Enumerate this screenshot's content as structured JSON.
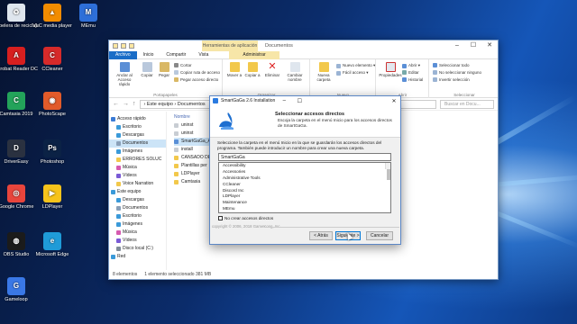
{
  "desktop_icons": [
    {
      "label": "Papelera de reciclaje",
      "icon": "recycle-bin-icon",
      "color": "#dfe6ee",
      "glyph": "♻"
    },
    {
      "label": "VLC media player",
      "icon": "vlc-icon",
      "color": "#f28c00",
      "glyph": "▲"
    },
    {
      "label": "MEmu",
      "icon": "memu-icon",
      "color": "#2e6fd8",
      "glyph": "M"
    },
    {
      "label": "Acrobat Reader DC",
      "icon": "acrobat-icon",
      "color": "#d71f1f",
      "glyph": "A"
    },
    {
      "label": "CCleaner",
      "icon": "ccleaner-icon",
      "color": "#d62a2a",
      "glyph": "C"
    },
    {
      "label": "Camtasia 2019",
      "icon": "camtasia-icon",
      "color": "#23a35a",
      "glyph": "C"
    },
    {
      "label": "PhotoScape",
      "icon": "photoscape-icon",
      "color": "#e25b2a",
      "glyph": "◉"
    },
    {
      "label": "DriverEasy",
      "icon": "drivereasy-icon",
      "color": "#2a3140",
      "glyph": "D"
    },
    {
      "label": "Photoshop",
      "icon": "photoshop-icon",
      "color": "#0b2245",
      "glyph": "Ps"
    },
    {
      "label": "Google Chrome",
      "icon": "chrome-icon",
      "color": "#e8453c",
      "glyph": "◎"
    },
    {
      "label": "LDPlayer",
      "icon": "ldplayer-icon",
      "color": "#f6c31b",
      "glyph": "▶"
    },
    {
      "label": "OBS Studio",
      "icon": "obs-icon",
      "color": "#1b1b1b",
      "glyph": "◍"
    },
    {
      "label": "Microsoft Edge",
      "icon": "edge-icon",
      "color": "#1f9bd8",
      "glyph": "e"
    },
    {
      "label": "Gameloop",
      "icon": "gameloop-icon",
      "color": "#3a78e6",
      "glyph": "G"
    }
  ],
  "explorer": {
    "title": "Documentos",
    "context_tab": "Herramientas de aplicación",
    "tabs": [
      "Archivo",
      "Inicio",
      "Compartir",
      "Vista",
      "Administrar"
    ],
    "ribbon": {
      "anclar": "Anclar al Acceso rápido",
      "copiar": "Copiar",
      "pegar": "Pegar",
      "cortar": "Cortar",
      "copiar_ruta": "Copiar ruta de acceso",
      "pegar_acceso": "Pegar acceso directo",
      "group_portapapeles": "Portapapeles",
      "mover": "Mover a",
      "copiar_a": "Copiar a",
      "eliminar": "Eliminar",
      "cambiar_nombre": "Cambiar nombre",
      "group_organizar": "Organizar",
      "nueva_carpeta": "Nueva carpeta",
      "nuevo_elemento": "Nuevo elemento ▾",
      "facil_acceso": "Fácil acceso ▾",
      "group_nuevo": "Nuevo",
      "propiedades": "Propiedades",
      "abrir": "Abrir ▾",
      "editar": "Editar",
      "historial": "Historial",
      "group_abrir": "Abrir",
      "sel_todo": "Seleccionar todo",
      "no_sel": "No seleccionar ninguno",
      "invertir": "Invertir selección",
      "group_seleccionar": "Seleccionar"
    },
    "address": "›  Este equipo  ›  Documentos",
    "search_placeholder": "Buscar en Docu...",
    "nav": [
      {
        "label": "Acceso rápido",
        "icon": "star-icon",
        "color": "#3a7bd5"
      },
      {
        "label": "Escritorio",
        "icon": "desktop-folder-icon",
        "color": "#3a9ad9"
      },
      {
        "label": "Descargas",
        "icon": "download-icon",
        "color": "#3a9ad9"
      },
      {
        "label": "Documentos",
        "icon": "documents-icon",
        "color": "#8aa0b8",
        "selected": true
      },
      {
        "label": "Imágenes",
        "icon": "pictures-icon",
        "color": "#3a9ad9"
      },
      {
        "label": "ERRORES SOLUC",
        "icon": "folder-icon",
        "color": "#f2c84b"
      },
      {
        "label": "Música",
        "icon": "music-icon",
        "color": "#d65ab0"
      },
      {
        "label": "Vídeos",
        "icon": "videos-icon",
        "color": "#7a5ad6"
      },
      {
        "label": "Voice Narration",
        "icon": "folder-icon",
        "color": "#f2c84b"
      },
      {
        "label": "Este equipo",
        "icon": "pc-icon",
        "color": "#3a9ad9"
      },
      {
        "label": "Descargas",
        "icon": "download-icon",
        "color": "#3a9ad9"
      },
      {
        "label": "Documentos",
        "icon": "documents-icon",
        "color": "#8aa0b8"
      },
      {
        "label": "Escritorio",
        "icon": "desktop-folder-icon",
        "color": "#3a9ad9"
      },
      {
        "label": "Imágenes",
        "icon": "pictures-icon",
        "color": "#3a9ad9"
      },
      {
        "label": "Música",
        "icon": "music-icon",
        "color": "#d65ab0"
      },
      {
        "label": "Vídeos",
        "icon": "videos-icon",
        "color": "#7a5ad6"
      },
      {
        "label": "Disco local (C:)",
        "icon": "drive-icon",
        "color": "#7f8c99"
      },
      {
        "label": "Red",
        "icon": "network-icon",
        "color": "#3a9ad9"
      }
    ],
    "column_name": "Nombre",
    "files": [
      {
        "name": "uninst",
        "color": "#c8cdd3"
      },
      {
        "name": "uninst",
        "color": "#c8cdd3"
      },
      {
        "name": "SmartGaGa_A",
        "color": "#5a8fd6",
        "selected": true
      },
      {
        "name": "install",
        "color": "#c8cdd3"
      },
      {
        "name": "CANSADO DE",
        "color": "#f2c84b"
      },
      {
        "name": "Plantillas per",
        "color": "#f2c84b"
      },
      {
        "name": "LDPlayer",
        "color": "#f2c84b"
      },
      {
        "name": "Camtasia",
        "color": "#f2c84b"
      }
    ],
    "status_count": "8 elementos",
    "status_selected": "1 elemento seleccionado  381 MB"
  },
  "dialog": {
    "title": "SmartGaGa 2.6 Installation",
    "heading": "Seleccionar accesos directos",
    "subheading": "Escoja la carpeta en el menú Inicio para los accesos directos de SmartGaGa.",
    "description": "Seleccione la carpeta en el menú Inicio en la que se guardarán los accesos directos del programa. También puede introducir un nombre para crear una nueva carpeta.",
    "folder_value": "SmartGaGa",
    "list": [
      "Accessibility",
      "Accessories",
      "Administrative Tools",
      "CCleaner",
      "Discord Inc",
      "LDPlayer",
      "Maintenance",
      "MEmu"
    ],
    "checkbox_label": "No crear accesos directos",
    "copyright": "copyright © 2006, 2018 GameKong, Inc.",
    "btn_back": "< Atrás",
    "btn_next": "Siguiente >",
    "btn_cancel": "Cancelar"
  }
}
